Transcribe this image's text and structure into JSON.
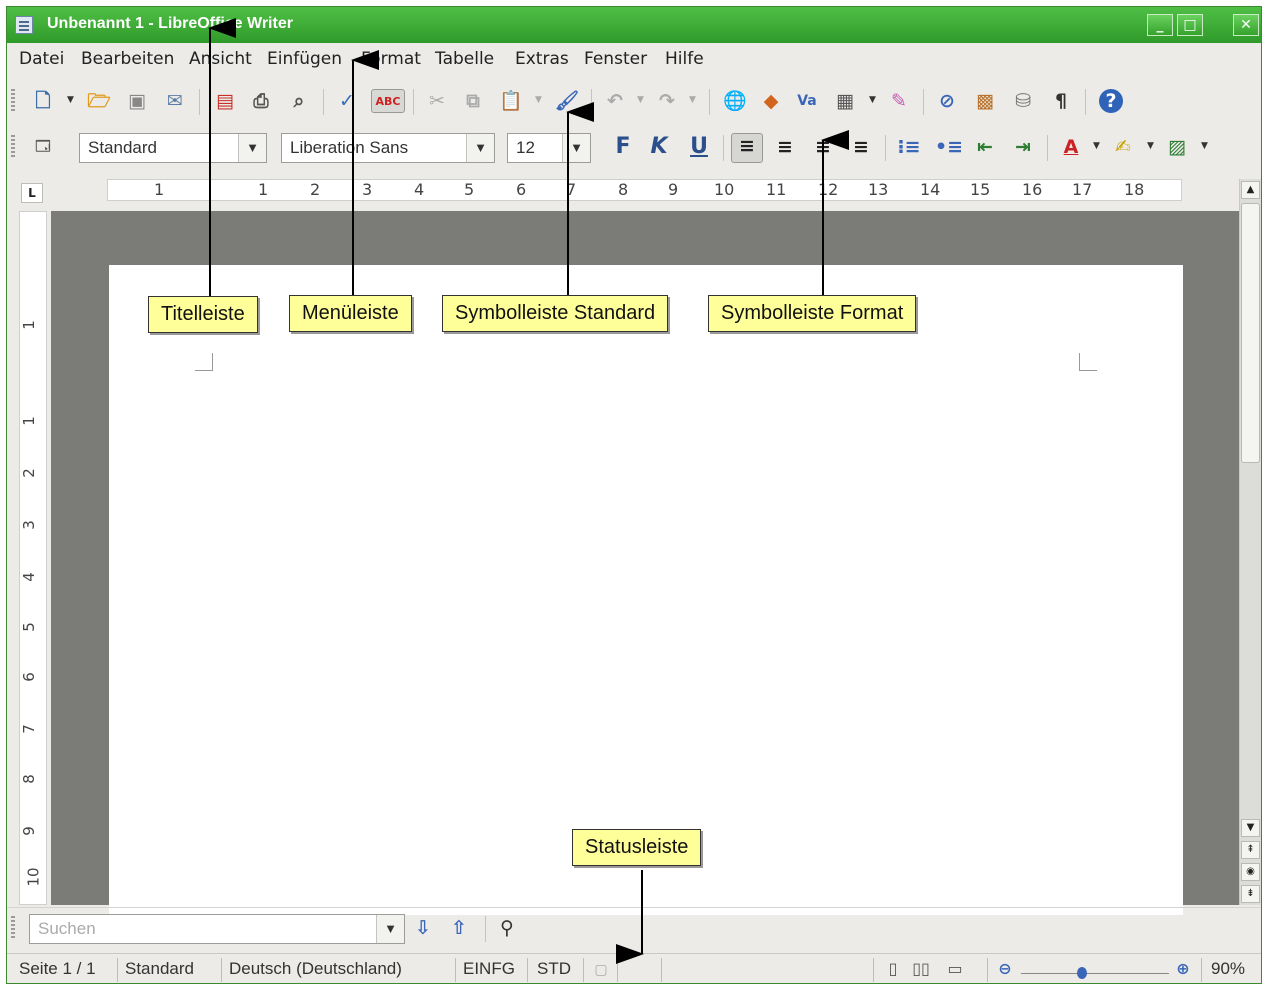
{
  "window": {
    "title": "Unbenannt 1 - LibreOffice Writer"
  },
  "menu": [
    "Datei",
    "Bearbeiten",
    "Ansicht",
    "Einfügen",
    "Format",
    "Tabelle",
    "Extras",
    "Fenster",
    "Hilfe"
  ],
  "format_toolbar": {
    "paragraph_style": "Standard",
    "font_name": "Liberation Sans",
    "font_size": "12",
    "bold": "F",
    "italic": "K",
    "underline": "U"
  },
  "ruler": {
    "h_labels": [
      "1",
      "1",
      "2",
      "3",
      "4",
      "5",
      "6",
      "7",
      "8",
      "9",
      "10",
      "11",
      "12",
      "13",
      "14",
      "15",
      "16",
      "17",
      "18"
    ],
    "v_labels": [
      "1",
      "1",
      "2",
      "3",
      "4",
      "5",
      "6",
      "7",
      "8",
      "9",
      "10"
    ]
  },
  "find": {
    "placeholder": "Suchen"
  },
  "status": {
    "page": "Seite 1 / 1",
    "style": "Standard",
    "language": "Deutsch (Deutschland)",
    "insert_mode": "EINFG",
    "selection_mode": "STD",
    "zoom": "90%"
  },
  "annotations": {
    "titelleiste": "Titelleiste",
    "menueleiste": "Menüleiste",
    "symbolleiste_standard": "Symbolleiste Standard",
    "symbolleiste_format": "Symbolleiste Format",
    "statusleiste": "Statusleiste"
  },
  "colors": {
    "titlebar": "#35a22c",
    "callout": "#ffff99",
    "workspace": "#7b7b78"
  }
}
